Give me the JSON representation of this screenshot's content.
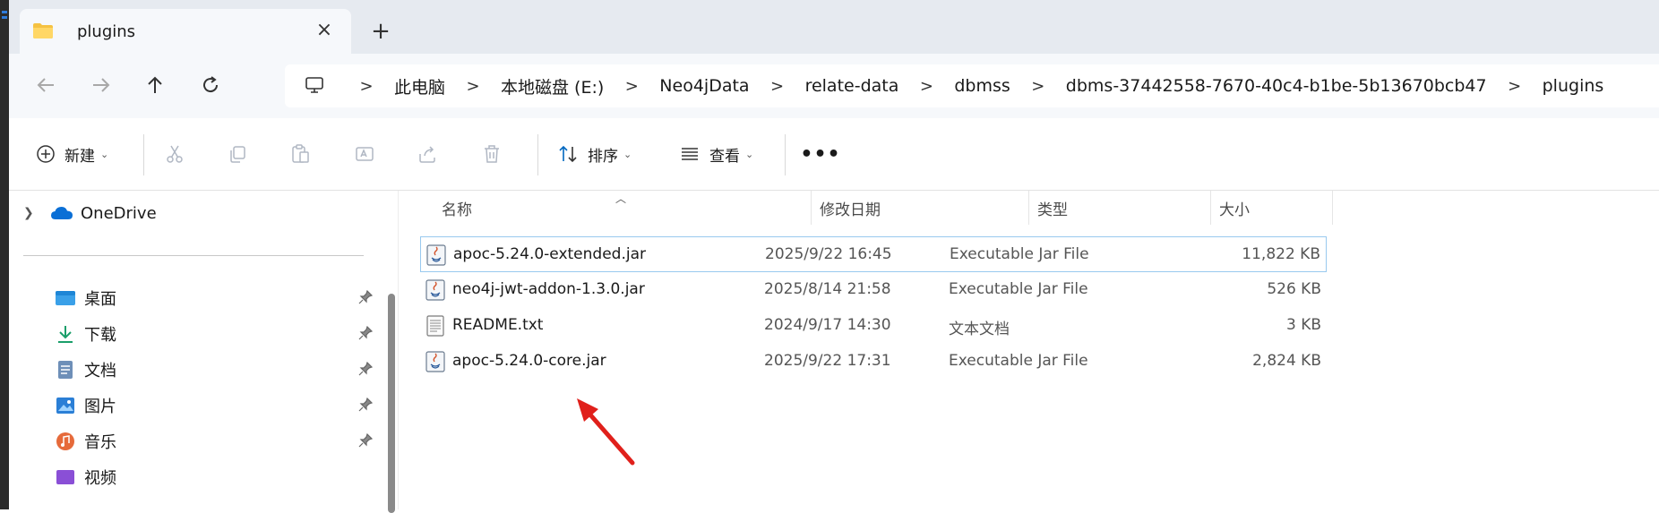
{
  "tab": {
    "title": "plugins",
    "close_icon": "×",
    "new_tab_icon": "+"
  },
  "breadcrumb": [
    "此电脑",
    "本地磁盘 (E:)",
    "Neo4jData",
    "relate-data",
    "dbmss",
    "dbms-37442558-7670-40c4-b1be-5b13670bcb47",
    "plugins"
  ],
  "breadcrumb_separator": ">",
  "toolbar": {
    "new_label": "新建",
    "sort_label": "排序",
    "view_label": "查看",
    "more_label": "•••"
  },
  "nav": {
    "onedrive": "OneDrive",
    "items": [
      {
        "label": "桌面",
        "icon": "desktop-icon"
      },
      {
        "label": "下载",
        "icon": "download-icon"
      },
      {
        "label": "文档",
        "icon": "documents-icon"
      },
      {
        "label": "图片",
        "icon": "pictures-icon"
      },
      {
        "label": "音乐",
        "icon": "music-icon"
      },
      {
        "label": "视频",
        "icon": "videos-icon"
      }
    ]
  },
  "columns": {
    "name": "名称",
    "date": "修改日期",
    "type": "类型",
    "size": "大小"
  },
  "files": [
    {
      "name": "apoc-5.24.0-extended.jar",
      "date": "2025/9/22 16:45",
      "type": "Executable Jar File",
      "size": "11,822 KB",
      "icon": "jar-file-icon",
      "selected": true
    },
    {
      "name": "neo4j-jwt-addon-1.3.0.jar",
      "date": "2025/8/14 21:58",
      "type": "Executable Jar File",
      "size": "526 KB",
      "icon": "jar-file-icon"
    },
    {
      "name": "README.txt",
      "date": "2024/9/17 14:30",
      "type": "文本文档",
      "size": "3 KB",
      "icon": "text-file-icon"
    },
    {
      "name": "apoc-5.24.0-core.jar",
      "date": "2025/9/22 17:31",
      "type": "Executable Jar File",
      "size": "2,824 KB",
      "icon": "jar-file-icon"
    }
  ],
  "colors": {
    "selection_border": "#99c9ef",
    "accent": "#0067c0",
    "annotation_arrow": "#e0201b"
  }
}
